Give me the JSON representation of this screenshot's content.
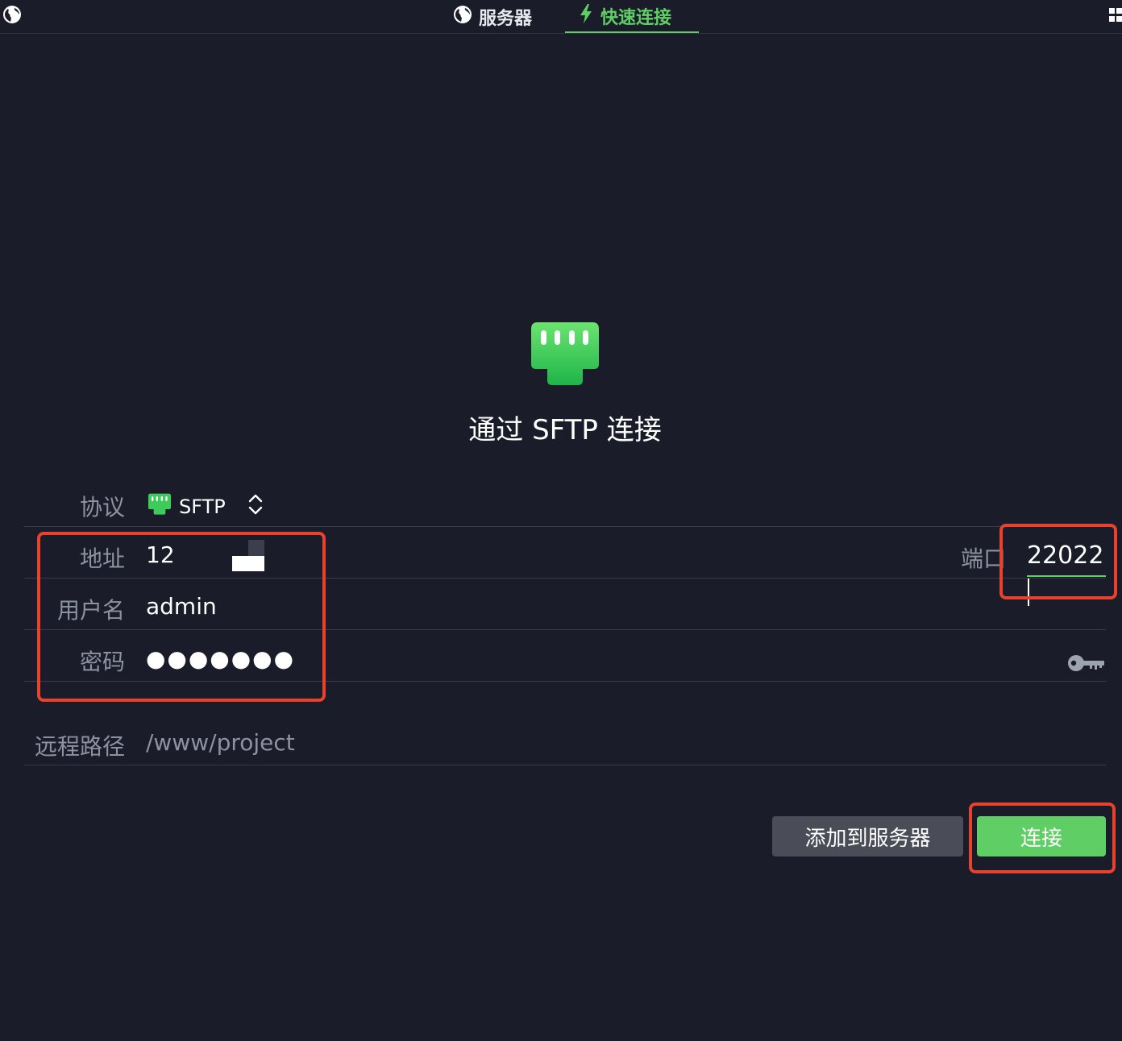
{
  "tabs": [
    {
      "label": "服务器",
      "icon": "globe-icon",
      "active": false
    },
    {
      "label": "快速连接",
      "icon": "bolt-icon",
      "active": true
    }
  ],
  "hero": {
    "icon": "ethernet-port-icon",
    "title": "通过 SFTP 连接"
  },
  "form": {
    "protocol": {
      "label": "协议",
      "value": "SFTP"
    },
    "address": {
      "label": "地址",
      "value": "12"
    },
    "port": {
      "label": "端口",
      "value": "22022"
    },
    "username": {
      "label": "用户名",
      "value": "admin"
    },
    "password": {
      "label": "密码",
      "value": "●●●●●●●"
    },
    "remote_path": {
      "label": "远程路径",
      "value": "/www/project"
    }
  },
  "buttons": {
    "add_to_servers": "添加到服务器",
    "connect": "连接"
  },
  "colors": {
    "background": "#1a1d29",
    "accent": "#5fcf65",
    "annotation": "#e8412c"
  }
}
